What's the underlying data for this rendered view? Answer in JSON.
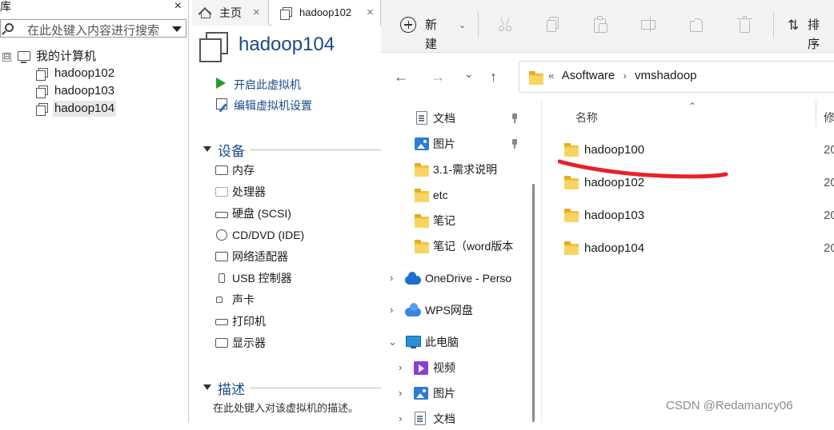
{
  "library": {
    "title": "库",
    "close": "×",
    "search_placeholder": "在此处键入内容进行搜索",
    "root_label": "我的计算机",
    "expander": "⊟",
    "vms": [
      "hadoop102",
      "hadoop103",
      "hadoop104"
    ]
  },
  "vm_tabs": {
    "home_label": "主页",
    "vm_tab_label": "hadoop102",
    "close": "×"
  },
  "vm_panel": {
    "title": "hadoop104",
    "start_action": "开启此虚拟机",
    "edit_action": "编辑虚拟机设置",
    "devices_header": "设备",
    "devices": [
      "内存",
      "处理器",
      "硬盘 (SCSI)",
      "CD/DVD (IDE)",
      "网络适配器",
      "USB 控制器",
      "声卡",
      "打印机",
      "显示器"
    ],
    "description_header": "描述",
    "description_placeholder": "在此处键入对该虚拟机的描述。"
  },
  "explorer": {
    "toolbar": {
      "new_label": "新建",
      "new_chevron": "⌄",
      "sort_label": "排序",
      "sort_icon": "⇅"
    },
    "nav": {
      "back": "←",
      "forward": "→",
      "recent": "⌄",
      "up": "↑"
    },
    "address": {
      "overflow": "«",
      "crumbs": [
        "Asoftware",
        "vmshadoop"
      ],
      "separator": "›"
    },
    "nav_pane": {
      "quick_access": [
        {
          "label": "文档",
          "icon": "document-icon",
          "pinned": true
        },
        {
          "label": "图片",
          "icon": "pictures-icon",
          "pinned": true
        },
        {
          "label": "3.1-需求说明",
          "icon": "folder-icon",
          "pinned": false
        },
        {
          "label": "etc",
          "icon": "folder-icon",
          "pinned": false
        },
        {
          "label": "笔记",
          "icon": "folder-icon",
          "pinned": false
        },
        {
          "label": "笔记（word版本",
          "icon": "folder-icon",
          "pinned": false
        }
      ],
      "onedrive": "OneDrive - Perso",
      "wps": "WPS网盘",
      "this_pc": "此电脑",
      "this_pc_children": [
        "视频",
        "图片",
        "文档"
      ],
      "chevron_right": "›",
      "chevron_down": "⌄"
    },
    "list": {
      "col_name": "名称",
      "col_modified": "修",
      "sort_caret": "⌃",
      "items": [
        {
          "name": "hadoop100",
          "date": "20"
        },
        {
          "name": "hadoop102",
          "date": "20"
        },
        {
          "name": "hadoop103",
          "date": "20"
        },
        {
          "name": "hadoop104",
          "date": "20"
        }
      ]
    }
  },
  "annotation": {
    "color": "#e8202a"
  },
  "watermark": "CSDN @Redamancy06"
}
